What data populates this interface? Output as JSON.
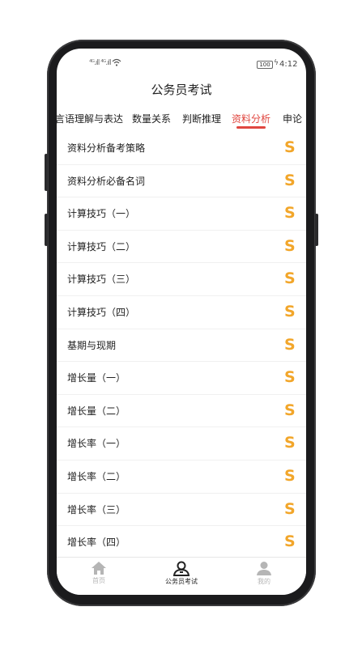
{
  "status_bar": {
    "signal": "⁴ᴳ.ıll ⁴ᴳ.ıll",
    "battery": "100",
    "time": "4:12"
  },
  "header": {
    "title": "公务员考试"
  },
  "tabs": [
    {
      "label": "言语理解与表达",
      "active": false
    },
    {
      "label": "数量关系",
      "active": false
    },
    {
      "label": "判断推理",
      "active": false
    },
    {
      "label": "资料分析",
      "active": true
    },
    {
      "label": "申论",
      "active": false
    }
  ],
  "list": {
    "icon": "S",
    "items": [
      "资料分析备考策略",
      "资料分析必备名词",
      "计算技巧（一）",
      "计算技巧（二）",
      "计算技巧（三）",
      "计算技巧（四）",
      "基期与现期",
      "增长量（一）",
      "增长量（二）",
      "增长率（一）",
      "增长率（二）",
      "增长率（三）",
      "增长率（四）"
    ]
  },
  "bottom_nav": [
    {
      "label": "首页",
      "icon": "home-icon",
      "active": false
    },
    {
      "label": "公务员考试",
      "icon": "exam-icon",
      "active": true
    },
    {
      "label": "我的",
      "icon": "user-icon",
      "active": false
    }
  ],
  "colors": {
    "accent": "#e0463f",
    "icon": "#f2a62a",
    "nav_active": "#222222",
    "nav_inactive": "#b5b5b5"
  }
}
